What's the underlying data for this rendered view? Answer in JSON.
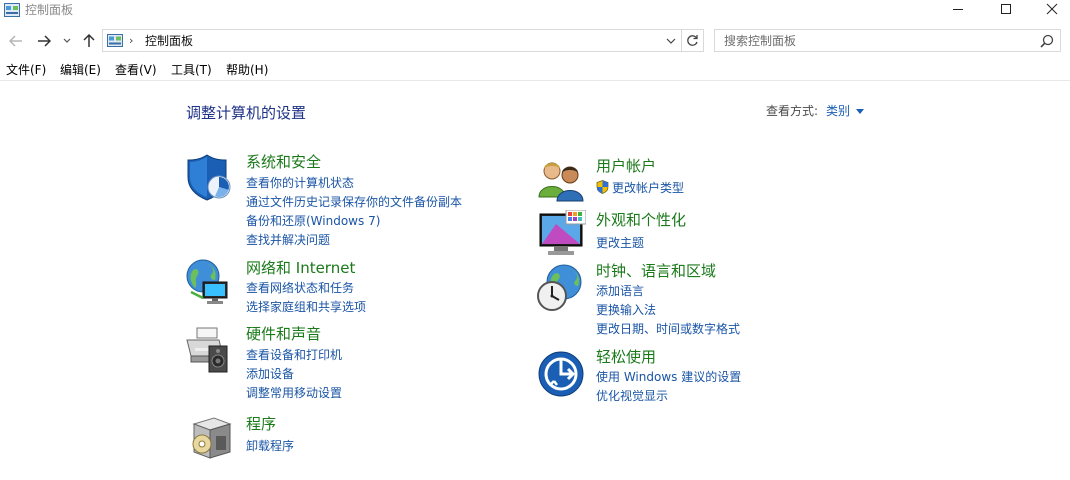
{
  "window": {
    "title": "控制面板",
    "icons": [
      "control-panel-icon",
      "minimize-icon",
      "maximize-icon",
      "close-icon"
    ]
  },
  "nav": {
    "back_icon": "back-arrow-icon",
    "forward_icon": "forward-arrow-icon",
    "recent_icon": "chevron-down-icon",
    "up_icon": "up-arrow-icon"
  },
  "address": {
    "separator": "›",
    "path": "控制面板"
  },
  "search": {
    "placeholder": "搜索控制面板"
  },
  "menu": {
    "file": "文件(F)",
    "edit": "编辑(E)",
    "view": "查看(V)",
    "tools": "工具(T)",
    "help": "帮助(H)"
  },
  "main": {
    "heading": "调整计算机的设置",
    "view_by_label": "查看方式:",
    "view_by_value": "类别"
  },
  "categories": {
    "system_security": {
      "title": "系统和安全",
      "links": [
        "查看你的计算机状态",
        "通过文件历史记录保存你的文件备份副本",
        "备份和还原(Windows 7)",
        "查找并解决问题"
      ]
    },
    "network": {
      "title": "网络和 Internet",
      "links": [
        "查看网络状态和任务",
        "选择家庭组和共享选项"
      ]
    },
    "hardware": {
      "title": "硬件和声音",
      "links": [
        "查看设备和打印机",
        "添加设备",
        "调整常用移动设置"
      ]
    },
    "programs": {
      "title": "程序",
      "links": [
        "卸载程序"
      ]
    },
    "user_accounts": {
      "title": "用户帐户",
      "links": [
        "更改帐户类型"
      ]
    },
    "appearance": {
      "title": "外观和个性化",
      "links": [
        "更改主题"
      ]
    },
    "clock_region": {
      "title": "时钟、语言和区域",
      "links": [
        "添加语言",
        "更换输入法",
        "更改日期、时间或数字格式"
      ]
    },
    "ease_of_access": {
      "title": "轻松使用",
      "links": [
        "使用 Windows 建议的设置",
        "优化视觉显示"
      ]
    }
  },
  "colors": {
    "category_title": "#1a7a1a",
    "link": "#1a55a6",
    "heading": "#1e3287"
  }
}
